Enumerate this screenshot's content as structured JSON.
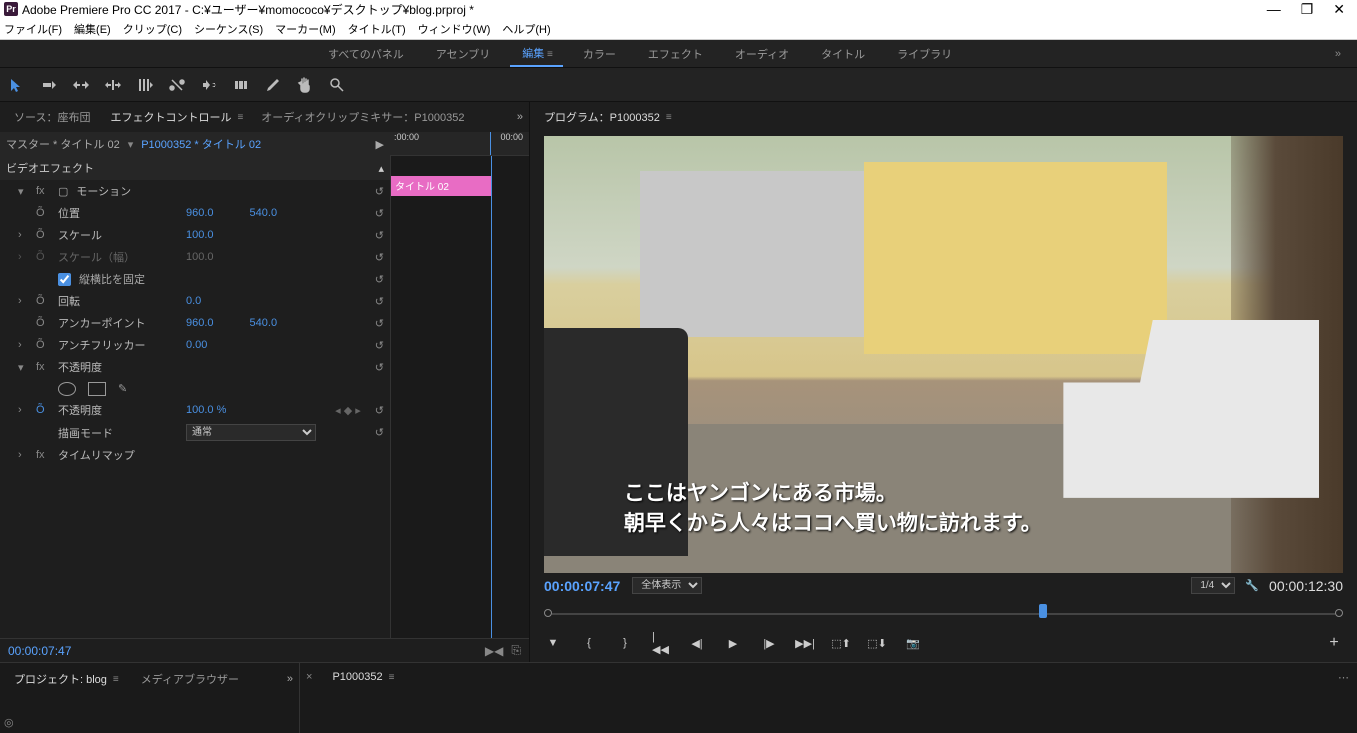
{
  "titlebar": {
    "app": "Adobe Premiere Pro CC 2017",
    "path": "C:¥ユーザー¥momococo¥デスクトップ¥blog.prproj *",
    "icon": "Pr"
  },
  "menu": [
    "ファイル(F)",
    "編集(E)",
    "クリップ(C)",
    "シーケンス(S)",
    "マーカー(M)",
    "タイトル(T)",
    "ウィンドウ(W)",
    "ヘルプ(H)"
  ],
  "workspaces": [
    "すべてのパネル",
    "アセンブリ",
    "編集",
    "カラー",
    "エフェクト",
    "オーディオ",
    "タイトル",
    "ライブラリ"
  ],
  "active_ws": "編集",
  "source_tabs": {
    "source": "ソース：座布団",
    "effect": "エフェクトコントロール",
    "mixer": "オーディオクリップミキサー：P1000352"
  },
  "effect_hdr": {
    "master": "マスター * タイトル 02",
    "seq": "P1000352  * タイトル 02",
    "ruler_start": ":00:00",
    "ruler_mid": "00:00",
    "clip": "タイトル 02"
  },
  "effects": {
    "video_fx_label": "ビデオエフェクト",
    "motion": {
      "label": "モーション",
      "position": {
        "label": "位置",
        "x": "960.0",
        "y": "540.0"
      },
      "scale": {
        "label": "スケール",
        "v": "100.0"
      },
      "scale_w": {
        "label": "スケール（幅）",
        "v": "100.0"
      },
      "aspect": {
        "label": "縦横比を固定",
        "checked": true
      },
      "rotation": {
        "label": "回転",
        "v": "0.0"
      },
      "anchor": {
        "label": "アンカーポイント",
        "x": "960.0",
        "y": "540.0"
      },
      "antiflicker": {
        "label": "アンチフリッカー",
        "v": "0.00"
      }
    },
    "opacity": {
      "label": "不透明度",
      "opacity": {
        "label": "不透明度",
        "v": "100.0 %"
      },
      "blend": {
        "label": "描画モード",
        "v": "通常"
      }
    },
    "timeremap": {
      "label": "タイムリマップ"
    }
  },
  "left_tc": "00:00:07:47",
  "program": {
    "tab": "プログラム：P1000352",
    "overlay1": "ここはヤンゴンにある市場。",
    "overlay2": "朝早くから人々はココへ買い物に訪れます。",
    "tc": "00:00:07:47",
    "fit": "全体表示",
    "zoom": "1/4",
    "dur": "00:00:12:30"
  },
  "project": {
    "tab1": "プロジェクト: blog",
    "tab2": "メディアブラウザー",
    "seq_tab": "P1000352"
  }
}
